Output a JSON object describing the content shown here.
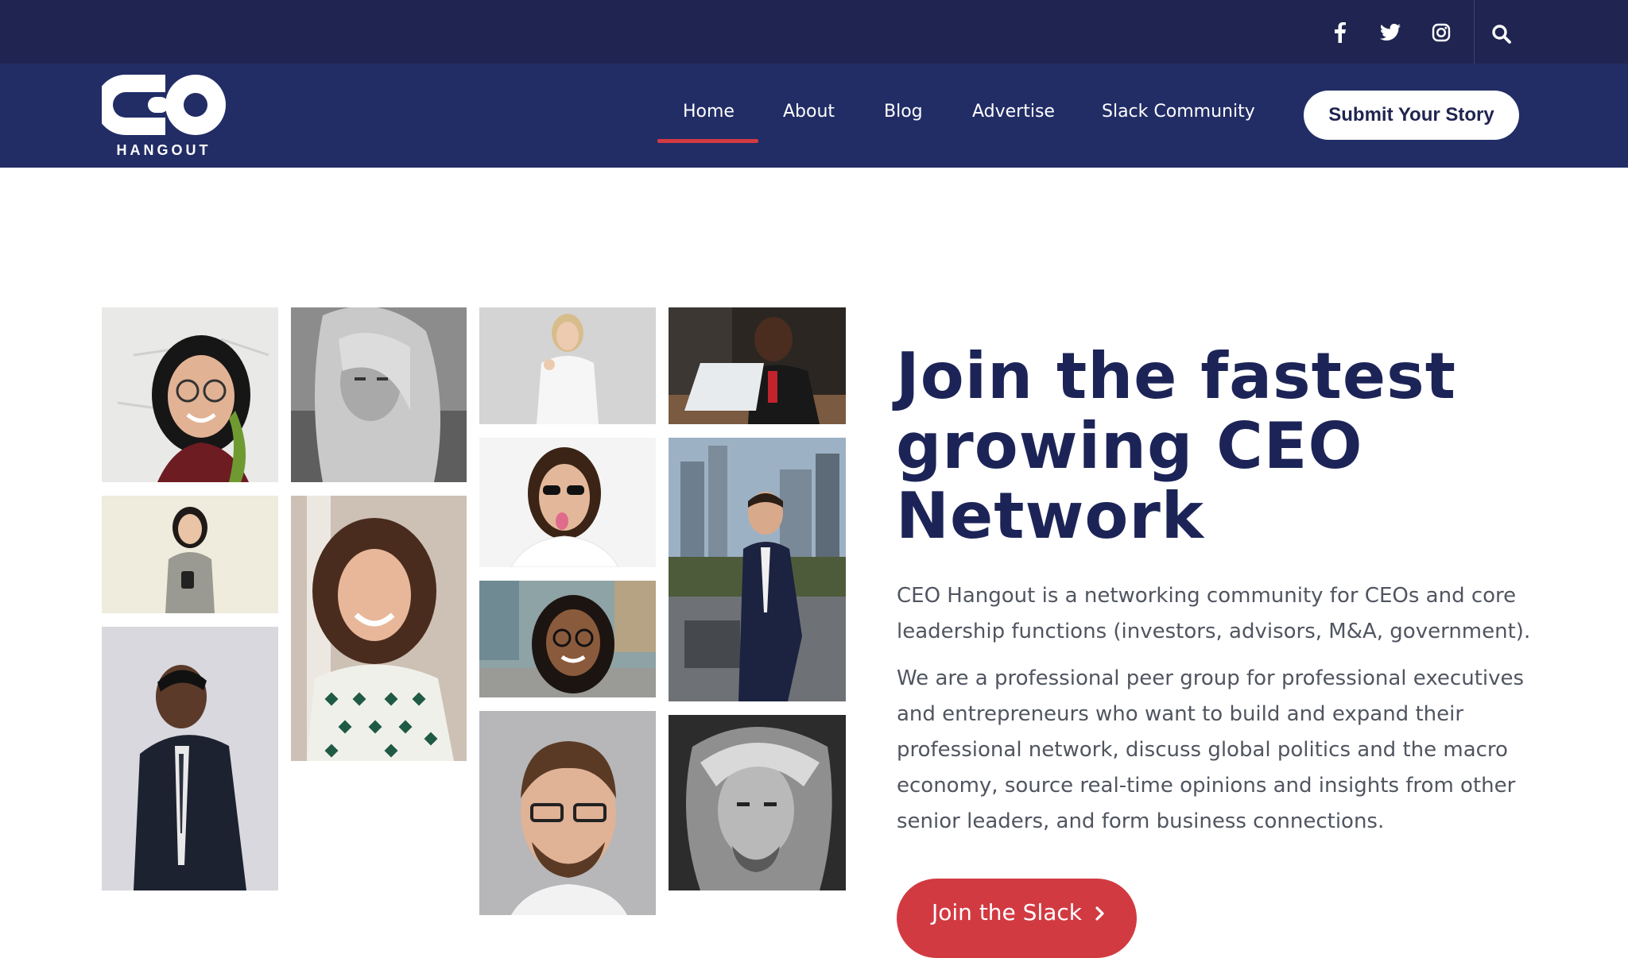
{
  "topbar": {
    "social_icons": [
      "facebook-icon",
      "twitter-icon",
      "instagram-icon"
    ],
    "search_icon": "search-icon"
  },
  "header": {
    "logo_text": "CEO",
    "logo_subtext": "HANGOUT",
    "nav": [
      {
        "label": "Home",
        "active": true
      },
      {
        "label": "About",
        "active": false
      },
      {
        "label": "Blog",
        "active": false
      },
      {
        "label": "Advertise",
        "active": false
      },
      {
        "label": "Slack Community",
        "active": false
      }
    ],
    "cta_label": "Submit Your Story"
  },
  "hero": {
    "headline_lines": [
      "Join the fastest",
      "growing CEO",
      "Network"
    ],
    "paragraph_1": "CEO Hangout is a networking community for CEOs and core leadership functions (investors, advisors, M&A, government).",
    "paragraph_2": "We are a professional peer group for professional executives and entrepreneurs who want to build and expand their professional network, discuss global politics and the macro economy, source real-time opinions and insights from other senior leaders, and form business connections.",
    "join_button_label": "Join the Slack",
    "join_button_icon": "chevron-right-icon"
  },
  "colors": {
    "topbar_bg": "#1f2550",
    "navbar_bg": "#222d66",
    "accent_red": "#d23a42",
    "headline_navy": "#1c2457",
    "body_text": "#505560"
  },
  "photo_grid": [
    {
      "name": "photo-woman-glasses-smiling"
    },
    {
      "name": "photo-woman-blonde-bw"
    },
    {
      "name": "photo-woman-white-shirt"
    },
    {
      "name": "photo-man-laptop"
    },
    {
      "name": "photo-woman-phone"
    },
    {
      "name": "photo-woman-curly-hair"
    },
    {
      "name": "photo-man-sunglasses"
    },
    {
      "name": "photo-man-suit-rooftop"
    },
    {
      "name": "photo-woman-glasses-street"
    },
    {
      "name": "photo-man-suit-tie"
    },
    {
      "name": "photo-man-glasses-beard"
    },
    {
      "name": "photo-man-long-hair-bw"
    }
  ]
}
